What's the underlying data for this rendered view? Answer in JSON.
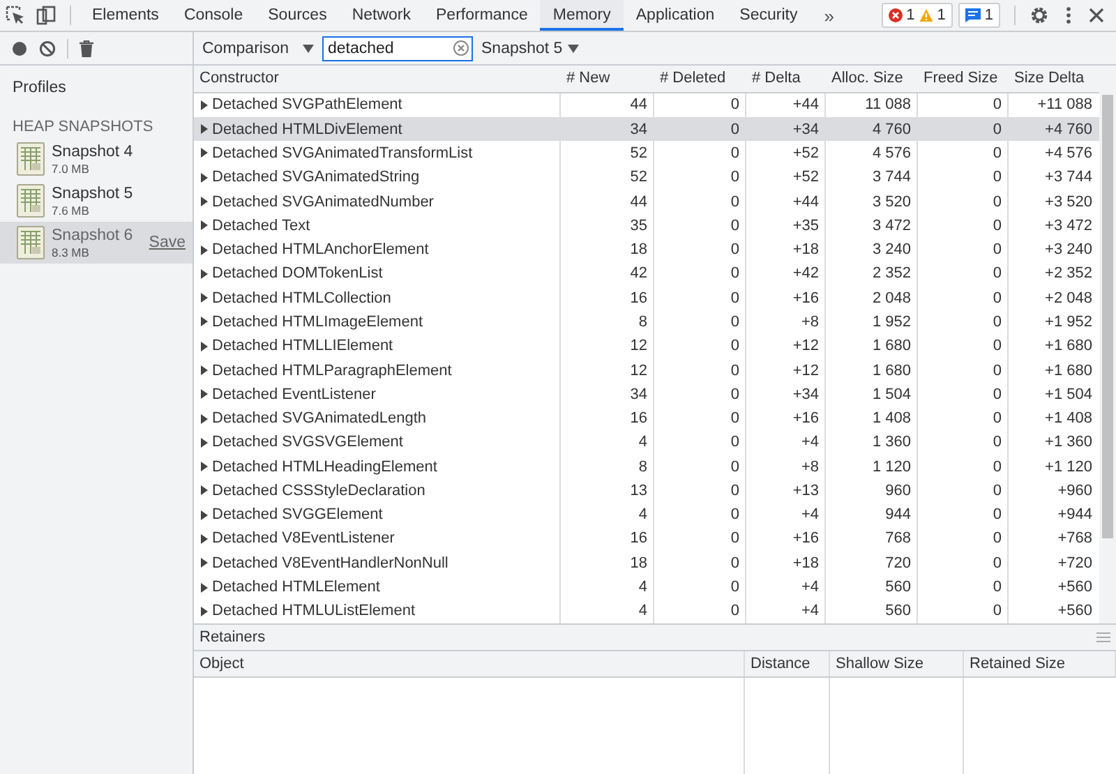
{
  "tabbar": {
    "tabs": [
      {
        "label": "Elements",
        "selected": false
      },
      {
        "label": "Console",
        "selected": false
      },
      {
        "label": "Sources",
        "selected": false
      },
      {
        "label": "Network",
        "selected": false
      },
      {
        "label": "Performance",
        "selected": false
      },
      {
        "label": "Memory",
        "selected": true
      },
      {
        "label": "Application",
        "selected": false
      },
      {
        "label": "Security",
        "selected": false
      }
    ],
    "more": "»",
    "errors": "1",
    "warnings": "1",
    "messages": "1"
  },
  "toolbar": {
    "view": "Comparison",
    "filter": {
      "value": "detached"
    },
    "baseline": "Snapshot 5"
  },
  "sidebar": {
    "title": "Profiles",
    "section": "HEAP SNAPSHOTS",
    "snapshots": [
      {
        "name": "Snapshot 4",
        "size": "7.0 MB",
        "selected": false
      },
      {
        "name": "Snapshot 5",
        "size": "7.6 MB",
        "selected": false
      },
      {
        "name": "Snapshot 6",
        "size": "8.3 MB",
        "selected": true,
        "action": "Save"
      }
    ]
  },
  "table": {
    "columns": [
      "Constructor",
      "# New",
      "# Deleted",
      "# Delta",
      "Alloc. Size",
      "Freed Size",
      "Size Delta"
    ],
    "rows": [
      {
        "cells": [
          "Detached SVGPathElement",
          "44",
          "0",
          "+44",
          "11 088",
          "0",
          "+11 088"
        ],
        "selected": false
      },
      {
        "cells": [
          "Detached HTMLDivElement",
          "34",
          "0",
          "+34",
          "4 760",
          "0",
          "+4 760"
        ],
        "selected": true
      },
      {
        "cells": [
          "Detached SVGAnimatedTransformList",
          "52",
          "0",
          "+52",
          "4 576",
          "0",
          "+4 576"
        ],
        "selected": false
      },
      {
        "cells": [
          "Detached SVGAnimatedString",
          "52",
          "0",
          "+52",
          "3 744",
          "0",
          "+3 744"
        ],
        "selected": false
      },
      {
        "cells": [
          "Detached SVGAnimatedNumber",
          "44",
          "0",
          "+44",
          "3 520",
          "0",
          "+3 520"
        ],
        "selected": false
      },
      {
        "cells": [
          "Detached Text",
          "35",
          "0",
          "+35",
          "3 472",
          "0",
          "+3 472"
        ],
        "selected": false
      },
      {
        "cells": [
          "Detached HTMLAnchorElement",
          "18",
          "0",
          "+18",
          "3 240",
          "0",
          "+3 240"
        ],
        "selected": false
      },
      {
        "cells": [
          "Detached DOMTokenList",
          "42",
          "0",
          "+42",
          "2 352",
          "0",
          "+2 352"
        ],
        "selected": false
      },
      {
        "cells": [
          "Detached HTMLCollection",
          "16",
          "0",
          "+16",
          "2 048",
          "0",
          "+2 048"
        ],
        "selected": false
      },
      {
        "cells": [
          "Detached HTMLImageElement",
          "8",
          "0",
          "+8",
          "1 952",
          "0",
          "+1 952"
        ],
        "selected": false
      },
      {
        "cells": [
          "Detached HTMLLIElement",
          "12",
          "0",
          "+12",
          "1 680",
          "0",
          "+1 680"
        ],
        "selected": false
      },
      {
        "cells": [
          "Detached HTMLParagraphElement",
          "12",
          "0",
          "+12",
          "1 680",
          "0",
          "+1 680"
        ],
        "selected": false
      },
      {
        "cells": [
          "Detached EventListener",
          "34",
          "0",
          "+34",
          "1 504",
          "0",
          "+1 504"
        ],
        "selected": false
      },
      {
        "cells": [
          "Detached SVGAnimatedLength",
          "16",
          "0",
          "+16",
          "1 408",
          "0",
          "+1 408"
        ],
        "selected": false
      },
      {
        "cells": [
          "Detached SVGSVGElement",
          "4",
          "0",
          "+4",
          "1 360",
          "0",
          "+1 360"
        ],
        "selected": false
      },
      {
        "cells": [
          "Detached HTMLHeadingElement",
          "8",
          "0",
          "+8",
          "1 120",
          "0",
          "+1 120"
        ],
        "selected": false
      },
      {
        "cells": [
          "Detached CSSStyleDeclaration",
          "13",
          "0",
          "+13",
          "960",
          "0",
          "+960"
        ],
        "selected": false
      },
      {
        "cells": [
          "Detached SVGGElement",
          "4",
          "0",
          "+4",
          "944",
          "0",
          "+944"
        ],
        "selected": false
      },
      {
        "cells": [
          "Detached V8EventListener",
          "16",
          "0",
          "+16",
          "768",
          "0",
          "+768"
        ],
        "selected": false
      },
      {
        "cells": [
          "Detached V8EventHandlerNonNull",
          "18",
          "0",
          "+18",
          "720",
          "0",
          "+720"
        ],
        "selected": false
      },
      {
        "cells": [
          "Detached HTMLElement",
          "4",
          "0",
          "+4",
          "560",
          "0",
          "+560"
        ],
        "selected": false
      },
      {
        "cells": [
          "Detached HTMLUListElement",
          "4",
          "0",
          "+4",
          "560",
          "0",
          "+560"
        ],
        "selected": false
      }
    ]
  },
  "retainers": {
    "title": "Retainers",
    "columns": [
      "Object",
      "Distance",
      "Shallow Size",
      "Retained Size"
    ]
  }
}
